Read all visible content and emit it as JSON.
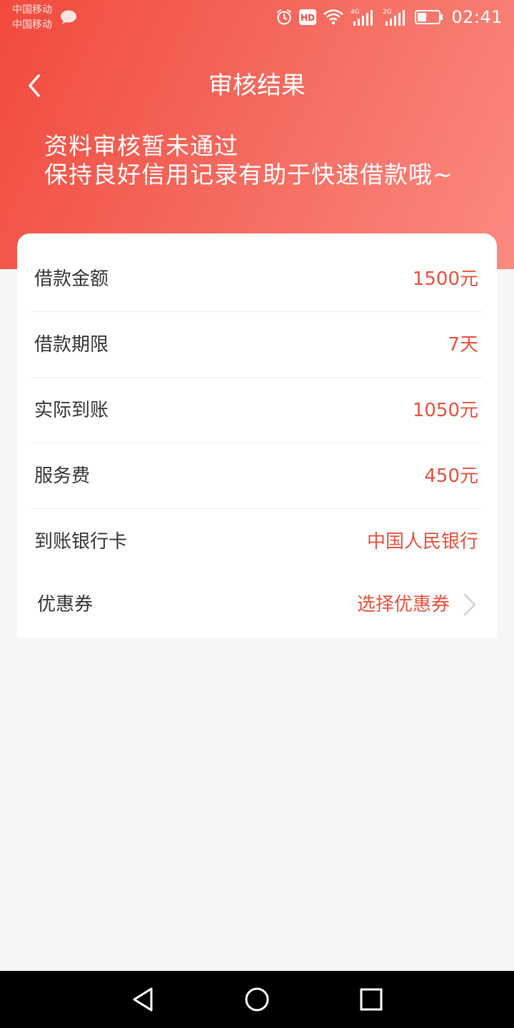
{
  "status_bar": {
    "carrier_1": "中国移动",
    "carrier_2": "中国移动",
    "time": "02:41",
    "hd_label": "HD",
    "net_1": "4G",
    "net_2": "2G",
    "icons": [
      "message-icon",
      "alarm-icon",
      "hd-icon",
      "wifi-icon",
      "signal-4g-icon",
      "signal-2g-icon",
      "battery-icon"
    ]
  },
  "nav": {
    "title": "审核结果",
    "back_icon": "chevron-left-icon"
  },
  "result": {
    "line1": "资料审核暂未通过",
    "line2": "保持良好信用记录有助于快速借款哦~"
  },
  "details": [
    {
      "label": "借款金额",
      "value": "1500元"
    },
    {
      "label": "借款期限",
      "value": "7天"
    },
    {
      "label": "实际到账",
      "value": "1050元"
    },
    {
      "label": "服务费",
      "value": "450元"
    },
    {
      "label": "到账银行卡",
      "value": "中国人民银行"
    },
    {
      "label": "优惠券",
      "value": "选择优惠券"
    }
  ],
  "colors": {
    "header_start": "#f24a3d",
    "header_end": "#fb8a80",
    "value_red": "#e8503d",
    "background": "#f6f6f6"
  },
  "system_nav": {
    "icons": [
      "back-triangle-icon",
      "home-circle-icon",
      "recents-square-icon"
    ]
  }
}
